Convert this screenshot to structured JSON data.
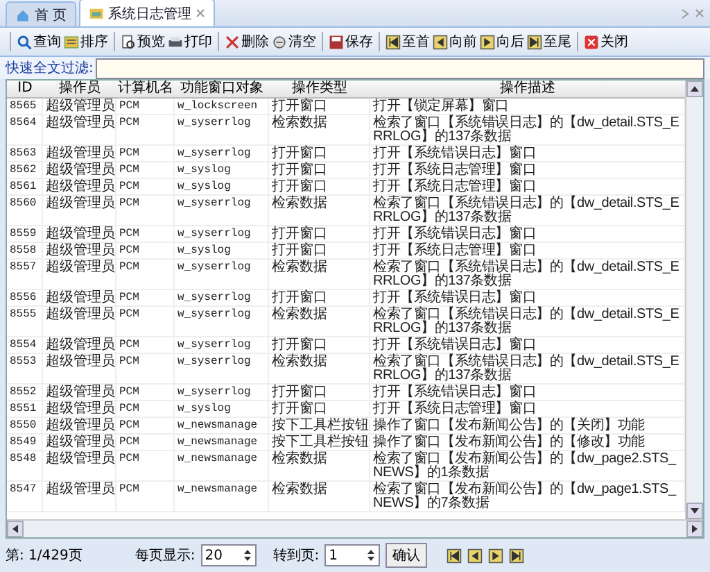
{
  "tabs": [
    {
      "label": "首 页",
      "kind": "home",
      "selected": false
    },
    {
      "label": "系统日志管理",
      "kind": "folder",
      "selected": true
    }
  ],
  "toolbar": [
    [
      {
        "label": "查询",
        "kind": "search"
      },
      {
        "label": "排序",
        "kind": "sort"
      }
    ],
    [
      {
        "label": "预览",
        "kind": "preview"
      },
      {
        "label": "打印",
        "kind": "print"
      }
    ],
    [
      {
        "label": "删除",
        "kind": "delete"
      },
      {
        "label": "清空",
        "kind": "clear"
      }
    ],
    [
      {
        "label": "保存",
        "kind": "save"
      }
    ],
    [
      {
        "label": "至首",
        "kind": "first"
      },
      {
        "label": "向前",
        "kind": "prev"
      },
      {
        "label": "向后",
        "kind": "next"
      },
      {
        "label": "至尾",
        "kind": "last"
      }
    ],
    [
      {
        "label": "关闭",
        "kind": "close"
      }
    ]
  ],
  "filter": {
    "label": "快速全文过滤:"
  },
  "table": {
    "columns": [
      "ID",
      "操作员",
      "计算机名",
      "功能窗口对象",
      "操作类型",
      "操作描述"
    ],
    "rows": [
      [
        "8565",
        "超级管理员",
        "PCM",
        "w_lockscreen",
        "打开窗口",
        "打开【锁定屏幕】窗口"
      ],
      [
        "8564",
        "超级管理员",
        "PCM",
        "w_syserrlog",
        "检索数据",
        "检索了窗口【系统错误日志】的【dw_detail.STS_ERRLOG】的137条数据"
      ],
      [
        "8563",
        "超级管理员",
        "PCM",
        "w_syserrlog",
        "打开窗口",
        "打开【系统错误日志】窗口"
      ],
      [
        "8562",
        "超级管理员",
        "PCM",
        "w_syslog",
        "打开窗口",
        "打开【系统日志管理】窗口"
      ],
      [
        "8561",
        "超级管理员",
        "PCM",
        "w_syslog",
        "打开窗口",
        "打开【系统日志管理】窗口"
      ],
      [
        "8560",
        "超级管理员",
        "PCM",
        "w_syserrlog",
        "检索数据",
        "检索了窗口【系统错误日志】的【dw_detail.STS_ERRLOG】的137条数据"
      ],
      [
        "8559",
        "超级管理员",
        "PCM",
        "w_syserrlog",
        "打开窗口",
        "打开【系统错误日志】窗口"
      ],
      [
        "8558",
        "超级管理员",
        "PCM",
        "w_syslog",
        "打开窗口",
        "打开【系统日志管理】窗口"
      ],
      [
        "8557",
        "超级管理员",
        "PCM",
        "w_syserrlog",
        "检索数据",
        "检索了窗口【系统错误日志】的【dw_detail.STS_ERRLOG】的137条数据"
      ],
      [
        "8556",
        "超级管理员",
        "PCM",
        "w_syserrlog",
        "打开窗口",
        "打开【系统错误日志】窗口"
      ],
      [
        "8555",
        "超级管理员",
        "PCM",
        "w_syserrlog",
        "检索数据",
        "检索了窗口【系统错误日志】的【dw_detail.STS_ERRLOG】的137条数据"
      ],
      [
        "8554",
        "超级管理员",
        "PCM",
        "w_syserrlog",
        "打开窗口",
        "打开【系统错误日志】窗口"
      ],
      [
        "8553",
        "超级管理员",
        "PCM",
        "w_syserrlog",
        "检索数据",
        "检索了窗口【系统错误日志】的【dw_detail.STS_ERRLOG】的137条数据"
      ],
      [
        "8552",
        "超级管理员",
        "PCM",
        "w_syserrlog",
        "打开窗口",
        "打开【系统错误日志】窗口"
      ],
      [
        "8551",
        "超级管理员",
        "PCM",
        "w_syslog",
        "打开窗口",
        "打开【系统日志管理】窗口"
      ],
      [
        "8550",
        "超级管理员",
        "PCM",
        "w_newsmanage",
        "按下工具栏按钮",
        "操作了窗口【发布新闻公告】的【关闭】功能"
      ],
      [
        "8549",
        "超级管理员",
        "PCM",
        "w_newsmanage",
        "按下工具栏按钮",
        "操作了窗口【发布新闻公告】的【修改】功能"
      ],
      [
        "8548",
        "超级管理员",
        "PCM",
        "w_newsmanage",
        "检索数据",
        "检索了窗口【发布新闻公告】的【dw_page2.STS_NEWS】的1条数据"
      ],
      [
        "8547",
        "超级管理员",
        "PCM",
        "w_newsmanage",
        "检索数据",
        "检索了窗口【发布新闻公告】的【dw_page1.STS_NEWS】的7条数据"
      ]
    ]
  },
  "pager": {
    "page_info": "第: 1/429页",
    "per_page_label": "每页显示:",
    "per_page": "20",
    "goto_label": "转到页:",
    "goto_page": "1",
    "confirm": "确认",
    "nav": [
      {
        "kind": "first"
      },
      {
        "kind": "prev"
      },
      {
        "kind": "next"
      },
      {
        "kind": "last"
      }
    ]
  }
}
